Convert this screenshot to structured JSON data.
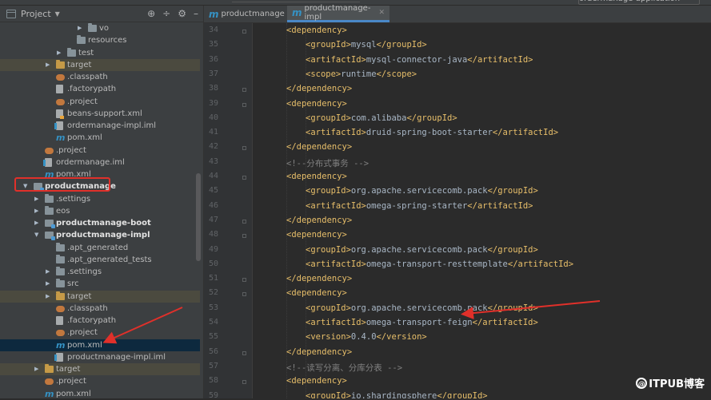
{
  "top_bar": {
    "run_config": "ordermanage-application"
  },
  "project_panel": {
    "title": "Project",
    "header_icons": [
      "target-icon",
      "collapse-icon",
      "gear-icon",
      "minimize-icon"
    ],
    "rows": [
      {
        "label": "vo",
        "indent": 110,
        "arrow": "right",
        "icon": "folder",
        "style": ""
      },
      {
        "label": "resources",
        "indent": 96,
        "arrow": "",
        "icon": "folder",
        "style": ""
      },
      {
        "label": "test",
        "indent": 84,
        "arrow": "right",
        "icon": "folder",
        "style": ""
      },
      {
        "label": "target",
        "indent": 70,
        "arrow": "right",
        "icon": "folder-y",
        "style": "hl"
      },
      {
        "label": ".classpath",
        "indent": 70,
        "arrow": "",
        "icon": "dot",
        "style": ""
      },
      {
        "label": ".factorypath",
        "indent": 70,
        "arrow": "",
        "icon": "file",
        "style": ""
      },
      {
        "label": ".project",
        "indent": 70,
        "arrow": "",
        "icon": "dot",
        "style": ""
      },
      {
        "label": "beans-support.xml",
        "indent": 70,
        "arrow": "",
        "icon": "xml",
        "style": ""
      },
      {
        "label": "ordermanage-impl.iml",
        "indent": 70,
        "arrow": "",
        "icon": "iml",
        "style": ""
      },
      {
        "label": "pom.xml",
        "indent": 70,
        "arrow": "",
        "icon": "m",
        "style": ""
      },
      {
        "label": ".project",
        "indent": 56,
        "arrow": "",
        "icon": "dot",
        "style": ""
      },
      {
        "label": "ordermanage.iml",
        "indent": 56,
        "arrow": "",
        "icon": "iml",
        "style": ""
      },
      {
        "label": "pom.xml",
        "indent": 56,
        "arrow": "",
        "icon": "m",
        "style": ""
      },
      {
        "label": "productmanage",
        "indent": 42,
        "arrow": "down",
        "icon": "module",
        "style": "bold"
      },
      {
        "label": ".settings",
        "indent": 56,
        "arrow": "right",
        "icon": "folder",
        "style": ""
      },
      {
        "label": "eos",
        "indent": 56,
        "arrow": "right",
        "icon": "folder",
        "style": ""
      },
      {
        "label": "productmanage-boot",
        "indent": 56,
        "arrow": "right",
        "icon": "module",
        "style": "bold"
      },
      {
        "label": "productmanage-impl",
        "indent": 56,
        "arrow": "down",
        "icon": "module",
        "style": "bold"
      },
      {
        "label": ".apt_generated",
        "indent": 70,
        "arrow": "",
        "icon": "folder",
        "style": ""
      },
      {
        "label": ".apt_generated_tests",
        "indent": 70,
        "arrow": "",
        "icon": "folder",
        "style": ""
      },
      {
        "label": ".settings",
        "indent": 70,
        "arrow": "right",
        "icon": "folder",
        "style": ""
      },
      {
        "label": "src",
        "indent": 70,
        "arrow": "right",
        "icon": "folder",
        "style": ""
      },
      {
        "label": "target",
        "indent": 70,
        "arrow": "right",
        "icon": "folder-y",
        "style": "hl"
      },
      {
        "label": ".classpath",
        "indent": 70,
        "arrow": "",
        "icon": "dot",
        "style": ""
      },
      {
        "label": ".factorypath",
        "indent": 70,
        "arrow": "",
        "icon": "file",
        "style": ""
      },
      {
        "label": ".project",
        "indent": 70,
        "arrow": "",
        "icon": "dot",
        "style": ""
      },
      {
        "label": "pom.xml",
        "indent": 70,
        "arrow": "",
        "icon": "m",
        "style": "sel"
      },
      {
        "label": "productmanage-impl.iml",
        "indent": 70,
        "arrow": "",
        "icon": "iml",
        "style": ""
      },
      {
        "label": "target",
        "indent": 56,
        "arrow": "right",
        "icon": "folder-y",
        "style": "hl"
      },
      {
        "label": ".project",
        "indent": 56,
        "arrow": "",
        "icon": "dot",
        "style": ""
      },
      {
        "label": "pom.xml",
        "indent": 56,
        "arrow": "",
        "icon": "m",
        "style": ""
      }
    ]
  },
  "editor": {
    "tabs": [
      {
        "label": "productmanage",
        "active": false
      },
      {
        "label": "productmanage-impl",
        "active": true
      }
    ],
    "lines": [
      {
        "n": "34",
        "indent": 1,
        "parts": [
          [
            "t",
            "<dependency>"
          ]
        ]
      },
      {
        "n": "35",
        "indent": 2,
        "parts": [
          [
            "t",
            "<groupId>"
          ],
          [
            "v",
            "mysql"
          ],
          [
            "t",
            "</groupId>"
          ]
        ]
      },
      {
        "n": "36",
        "indent": 2,
        "parts": [
          [
            "t",
            "<artifactId>"
          ],
          [
            "v",
            "mysql-connector-java"
          ],
          [
            "t",
            "</artifactId>"
          ]
        ]
      },
      {
        "n": "37",
        "indent": 2,
        "parts": [
          [
            "t",
            "<scope>"
          ],
          [
            "v",
            "runtime"
          ],
          [
            "t",
            "</scope>"
          ]
        ]
      },
      {
        "n": "38",
        "indent": 1,
        "parts": [
          [
            "t",
            "</dependency>"
          ]
        ]
      },
      {
        "n": "39",
        "indent": 1,
        "parts": [
          [
            "t",
            "<dependency>"
          ]
        ]
      },
      {
        "n": "40",
        "indent": 2,
        "parts": [
          [
            "t",
            "<groupId>"
          ],
          [
            "v",
            "com.alibaba"
          ],
          [
            "t",
            "</groupId>"
          ]
        ]
      },
      {
        "n": "41",
        "indent": 2,
        "parts": [
          [
            "t",
            "<artifactId>"
          ],
          [
            "v",
            "druid-spring-boot-starter"
          ],
          [
            "t",
            "</artifactId>"
          ]
        ]
      },
      {
        "n": "42",
        "indent": 1,
        "parts": [
          [
            "t",
            "</dependency>"
          ]
        ]
      },
      {
        "n": "43",
        "indent": 1,
        "parts": [
          [
            "c",
            "<!--分布式事务 -->"
          ]
        ]
      },
      {
        "n": "44",
        "indent": 1,
        "parts": [
          [
            "t",
            "<dependency>"
          ]
        ]
      },
      {
        "n": "45",
        "indent": 2,
        "parts": [
          [
            "t",
            "<groupId>"
          ],
          [
            "v",
            "org.apache.servicecomb.pack"
          ],
          [
            "t",
            "</groupId>"
          ]
        ]
      },
      {
        "n": "46",
        "indent": 2,
        "parts": [
          [
            "t",
            "<artifactId>"
          ],
          [
            "v",
            "omega-spring-starter"
          ],
          [
            "t",
            "</artifactId>"
          ]
        ]
      },
      {
        "n": "47",
        "indent": 1,
        "parts": [
          [
            "t",
            "</dependency>"
          ]
        ]
      },
      {
        "n": "48",
        "indent": 1,
        "parts": [
          [
            "t",
            "<dependency>"
          ]
        ]
      },
      {
        "n": "49",
        "indent": 2,
        "parts": [
          [
            "t",
            "<groupId>"
          ],
          [
            "v",
            "org.apache.servicecomb.pack"
          ],
          [
            "t",
            "</groupId>"
          ]
        ]
      },
      {
        "n": "50",
        "indent": 2,
        "parts": [
          [
            "t",
            "<artifactId>"
          ],
          [
            "v",
            "omega-transport-resttemplate"
          ],
          [
            "t",
            "</artifactId>"
          ]
        ]
      },
      {
        "n": "51",
        "indent": 1,
        "parts": [
          [
            "t",
            "</dependency>"
          ]
        ]
      },
      {
        "n": "52",
        "indent": 1,
        "parts": [
          [
            "t",
            "<dependency>"
          ]
        ]
      },
      {
        "n": "53",
        "indent": 2,
        "parts": [
          [
            "t",
            "<groupId>"
          ],
          [
            "v",
            "org.apache.servicecomb.pack"
          ],
          [
            "t",
            "</groupId>"
          ]
        ]
      },
      {
        "n": "54",
        "indent": 2,
        "parts": [
          [
            "t",
            "<artifactId>"
          ],
          [
            "v",
            "omega-transport-feign"
          ],
          [
            "t",
            "</artifactId>"
          ]
        ]
      },
      {
        "n": "55",
        "indent": 2,
        "parts": [
          [
            "t",
            "<version>"
          ],
          [
            "v",
            "0.4.0"
          ],
          [
            "t",
            "</version>"
          ]
        ]
      },
      {
        "n": "56",
        "indent": 1,
        "parts": [
          [
            "t",
            "</dependency>"
          ]
        ]
      },
      {
        "n": "57",
        "indent": 1,
        "parts": [
          [
            "c",
            "<!--读写分离、分库分表 -->"
          ]
        ]
      },
      {
        "n": "58",
        "indent": 1,
        "parts": [
          [
            "t",
            "<dependency>"
          ]
        ]
      },
      {
        "n": "59",
        "indent": 2,
        "parts": [
          [
            "t",
            "<groupId>"
          ],
          [
            "v",
            "io.shardingsphere"
          ],
          [
            "t",
            "</groupId>"
          ]
        ]
      }
    ]
  },
  "watermark": {
    "at": "@",
    "text": "ITPUB博客"
  },
  "colors": {
    "annotation": "#e0302a",
    "tag": "#e8bf6a",
    "text": "#a9b7c6",
    "comment": "#808080"
  }
}
